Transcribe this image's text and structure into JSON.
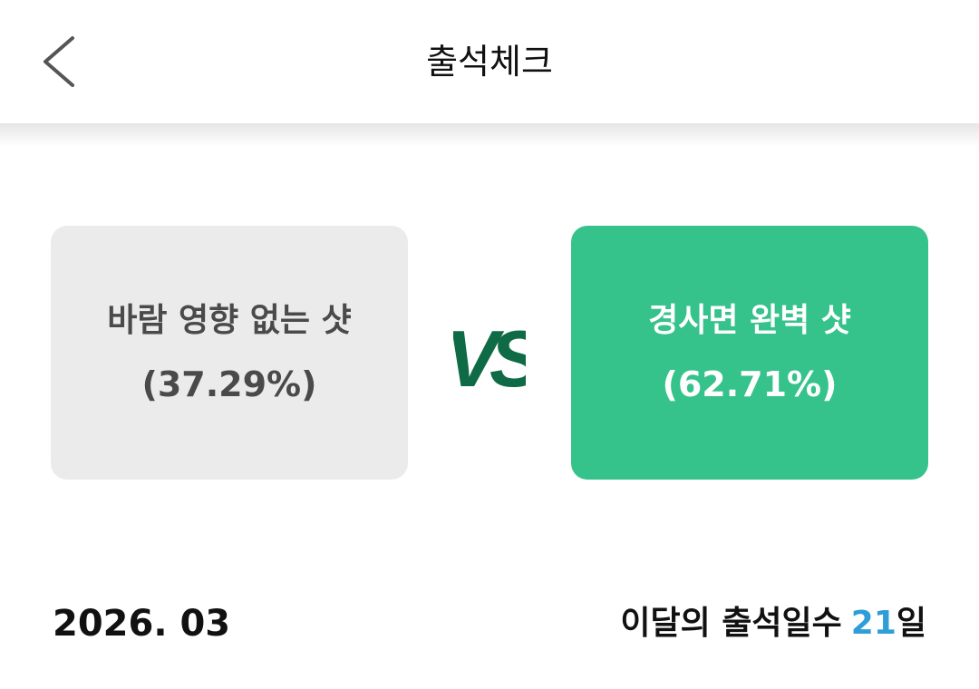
{
  "header": {
    "title": "출석체크",
    "back_icon": "chevron-left-icon"
  },
  "vote": {
    "left": {
      "label": "바람 영향 없는 샷",
      "percent": "(37.29%)",
      "value": 37.29,
      "color": "#ebebeb"
    },
    "vs_label": "VS",
    "right": {
      "label": "경사면 완벽 샷",
      "percent": "(62.71%)",
      "value": 62.71,
      "color": "#35c28b"
    },
    "vs_color": "#0f6b45"
  },
  "footer": {
    "date": "2026. 03",
    "attendance_label": "이달의 출석일수",
    "attendance_count": "21",
    "attendance_unit": "일",
    "accent_color": "#2f9ed8"
  }
}
